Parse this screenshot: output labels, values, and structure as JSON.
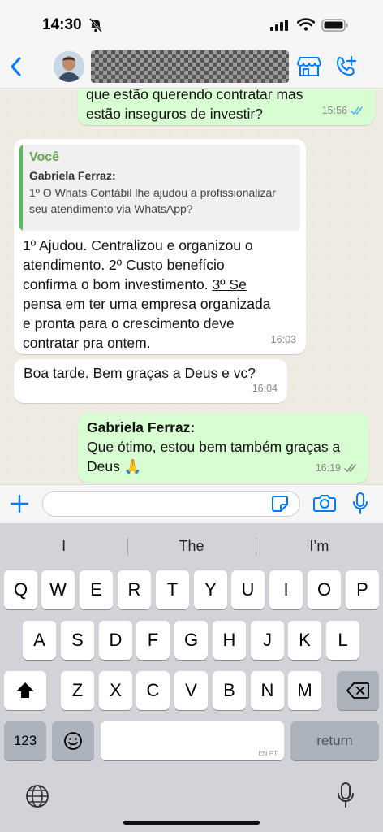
{
  "status_bar": {
    "time": "14:30"
  },
  "header": {
    "contact_name": ""
  },
  "messages": [
    {
      "direction": "outgoing",
      "lines": [
        "que estão querendo contratar mas",
        "estão inseguros de investir?"
      ],
      "time": "15:56",
      "ticks": "read"
    },
    {
      "direction": "incoming",
      "quote": {
        "author_label": "Você",
        "name": "Gabriela Ferraz:",
        "lines": [
          "1º O Whats Contábil lhe ajudou a profissionalizar",
          "seu atendimento via WhatsApp?"
        ]
      },
      "line1": "1º Ajudou. Centralizou e organizou o",
      "line2": "atendimento. 2º Custo benefício",
      "line3a": "confirma o bom investimento. ",
      "line3b": "3º Se",
      "line4a": "pensa em ter",
      "line4b": " uma empresa organizada",
      "line5": "e pronta para o crescimento deve",
      "line6": "contratar pra ontem.",
      "time": "16:03"
    },
    {
      "direction": "incoming",
      "text": "Boa tarde. Bem graças a Deus e vc?",
      "time": "16:04"
    },
    {
      "direction": "outgoing",
      "name": "Gabriela Ferraz:",
      "line1": "Que ótimo, estou bem também graças a",
      "line2": "Deus 🙏",
      "time": "16:19",
      "ticks": "delivered"
    }
  ],
  "input": {
    "placeholder": "",
    "value": ""
  },
  "keyboard": {
    "suggestions": [
      "I",
      "The",
      "I’m"
    ],
    "row1": [
      "Q",
      "W",
      "E",
      "R",
      "T",
      "Y",
      "U",
      "I",
      "O",
      "P"
    ],
    "row2": [
      "A",
      "S",
      "D",
      "F",
      "G",
      "H",
      "J",
      "K",
      "L"
    ],
    "row3": [
      "Z",
      "X",
      "C",
      "V",
      "B",
      "N",
      "M"
    ],
    "numbers_label": "123",
    "space_hint": "EN PT",
    "return_label": "return"
  },
  "colors": {
    "accent": "#007aff",
    "outgoing_bubble": "#d9fdd3",
    "incoming_bubble": "#ffffff",
    "read_ticks": "#53bdeb",
    "quote_bar": "#5cb85c"
  }
}
